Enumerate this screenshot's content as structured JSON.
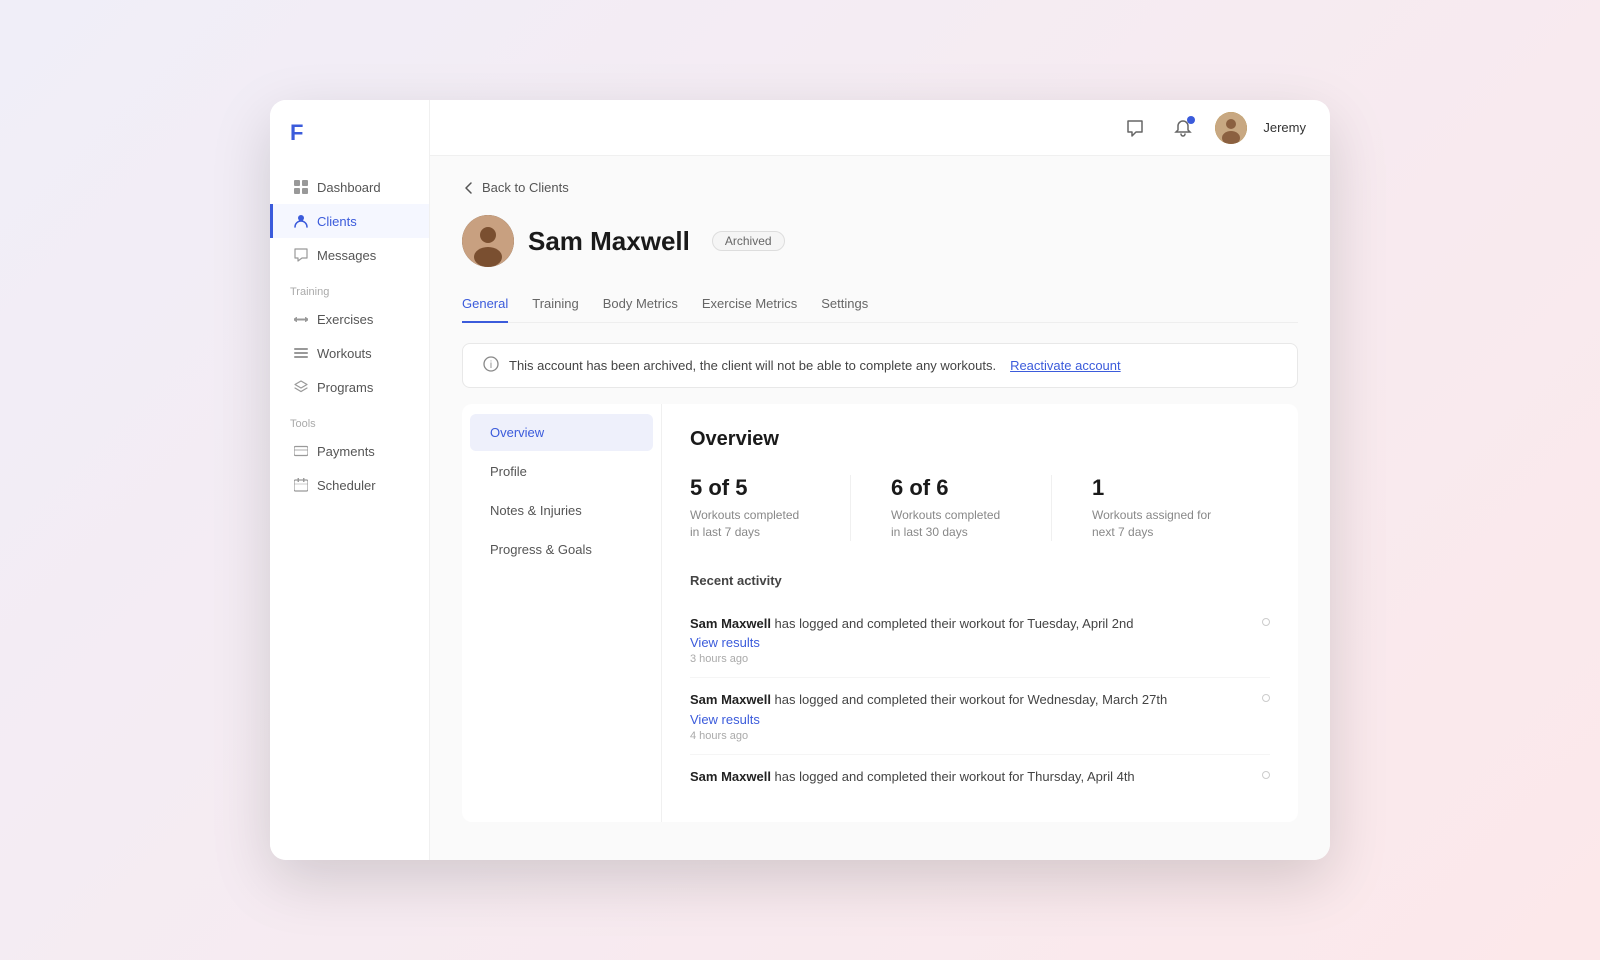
{
  "sidebar": {
    "logo": "F",
    "nav": [
      {
        "id": "dashboard",
        "label": "Dashboard",
        "icon": "grid",
        "active": false
      },
      {
        "id": "clients",
        "label": "Clients",
        "icon": "user",
        "active": true
      },
      {
        "id": "messages",
        "label": "Messages",
        "icon": "message",
        "active": false
      }
    ],
    "training_label": "Training",
    "training_nav": [
      {
        "id": "exercises",
        "label": "Exercises",
        "icon": "dumbbell"
      },
      {
        "id": "workouts",
        "label": "Workouts",
        "icon": "list"
      },
      {
        "id": "programs",
        "label": "Programs",
        "icon": "layers"
      }
    ],
    "tools_label": "Tools",
    "tools_nav": [
      {
        "id": "payments",
        "label": "Payments",
        "icon": "card"
      },
      {
        "id": "scheduler",
        "label": "Scheduler",
        "icon": "calendar"
      }
    ]
  },
  "topbar": {
    "username": "Jeremy",
    "chat_icon": "💬",
    "bell_icon": "🔔"
  },
  "back_link": "Back to Clients",
  "client": {
    "name": "Sam Maxwell",
    "status": "Archived"
  },
  "tabs": [
    {
      "id": "general",
      "label": "General",
      "active": true
    },
    {
      "id": "training",
      "label": "Training",
      "active": false
    },
    {
      "id": "body-metrics",
      "label": "Body Metrics",
      "active": false
    },
    {
      "id": "exercise-metrics",
      "label": "Exercise Metrics",
      "active": false
    },
    {
      "id": "settings",
      "label": "Settings",
      "active": false
    }
  ],
  "alert": {
    "message": "This account has been archived, the client will not be able to complete any workouts.",
    "action_label": "Reactivate account"
  },
  "sidebar_menu": [
    {
      "id": "overview",
      "label": "Overview",
      "active": true
    },
    {
      "id": "profile",
      "label": "Profile",
      "active": false
    },
    {
      "id": "notes",
      "label": "Notes & Injuries",
      "active": false
    },
    {
      "id": "progress",
      "label": "Progress & Goals",
      "active": false
    }
  ],
  "overview": {
    "title": "Overview",
    "stats": [
      {
        "value": "5 of 5",
        "label": "Workouts completed in last 7 days"
      },
      {
        "value": "6 of 6",
        "label": "Workouts completed in last 30 days"
      },
      {
        "value": "1",
        "label": "Workouts assigned for next 7 days"
      }
    ],
    "recent_activity_title": "Recent activity",
    "activities": [
      {
        "name": "Sam Maxwell",
        "text": " has logged and completed their workout for Tuesday, April 2nd",
        "link": "View results",
        "time": "3 hours ago"
      },
      {
        "name": "Sam Maxwell",
        "text": " has logged and completed their workout for Wednesday, March 27th",
        "link": "View results",
        "time": "4 hours ago"
      },
      {
        "name": "Sam Maxwell",
        "text": " has logged and completed their workout for Thursday, April 4th",
        "link": "",
        "time": ""
      }
    ]
  }
}
